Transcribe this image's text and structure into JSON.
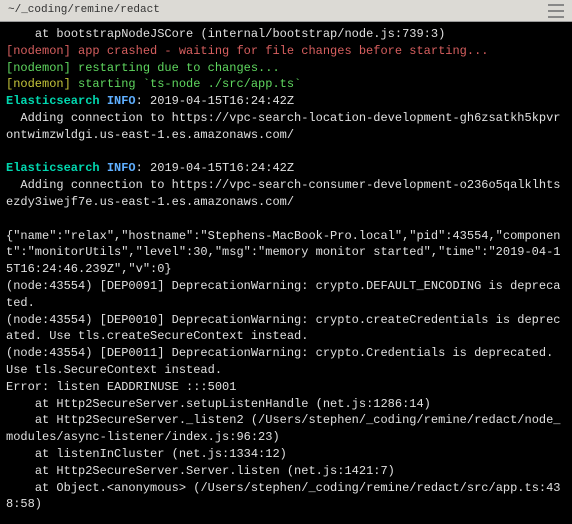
{
  "title": "~/_coding/remine/redact",
  "lines": [
    {
      "segments": [
        {
          "text": "    at bootstrapNodeJSCore (internal/bootstrap/node.js:739:3)",
          "cls": "white"
        }
      ]
    },
    {
      "segments": [
        {
          "text": "[nodemon] app crashed - waiting for file changes before starting...",
          "cls": "red"
        }
      ]
    },
    {
      "segments": [
        {
          "text": "[nodemon] restarting due to changes...",
          "cls": "green"
        }
      ]
    },
    {
      "segments": [
        {
          "text": "[nodemon] ",
          "cls": "yellow"
        },
        {
          "text": "starting `ts-node ./src/app.ts`",
          "cls": "green"
        }
      ]
    },
    {
      "segments": [
        {
          "text": "Elasticsearch ",
          "cls": "label-green"
        },
        {
          "text": "INFO",
          "cls": "label-blue"
        },
        {
          "text": ": 2019-04-15T16:24:42Z",
          "cls": "white"
        }
      ]
    },
    {
      "segments": [
        {
          "text": "  Adding connection to https://vpc-search-location-development-gh6zsatkh5kpvrontwimzwldgi.us-east-1.es.amazonaws.com/",
          "cls": "white"
        }
      ]
    },
    {
      "segments": [
        {
          "text": " ",
          "cls": "white"
        }
      ]
    },
    {
      "segments": [
        {
          "text": "Elasticsearch ",
          "cls": "label-green"
        },
        {
          "text": "INFO",
          "cls": "label-blue"
        },
        {
          "text": ": 2019-04-15T16:24:42Z",
          "cls": "white"
        }
      ]
    },
    {
      "segments": [
        {
          "text": "  Adding connection to https://vpc-search-consumer-development-o236o5qalklhtsezdy3iwejf7e.us-east-1.es.amazonaws.com/",
          "cls": "white"
        }
      ]
    },
    {
      "segments": [
        {
          "text": " ",
          "cls": "white"
        }
      ]
    },
    {
      "segments": [
        {
          "text": "{\"name\":\"relax\",\"hostname\":\"Stephens-MacBook-Pro.local\",\"pid\":43554,\"component\":\"monitorUtils\",\"level\":30,\"msg\":\"memory monitor started\",\"time\":\"2019-04-15T16:24:46.239Z\",\"v\":0}",
          "cls": "white"
        }
      ]
    },
    {
      "segments": [
        {
          "text": "(node:43554) [DEP0091] DeprecationWarning: crypto.DEFAULT_ENCODING is deprecated.",
          "cls": "white"
        }
      ]
    },
    {
      "segments": [
        {
          "text": "(node:43554) [DEP0010] DeprecationWarning: crypto.createCredentials is deprecated. Use tls.createSecureContext instead.",
          "cls": "white"
        }
      ]
    },
    {
      "segments": [
        {
          "text": "(node:43554) [DEP0011] DeprecationWarning: crypto.Credentials is deprecated. Use tls.SecureContext instead.",
          "cls": "white"
        }
      ]
    },
    {
      "segments": [
        {
          "text": "Error: listen EADDRINUSE :::5001",
          "cls": "white"
        }
      ]
    },
    {
      "segments": [
        {
          "text": "    at Http2SecureServer.setupListenHandle (net.js:1286:14)",
          "cls": "white"
        }
      ]
    },
    {
      "segments": [
        {
          "text": "    at Http2SecureServer._listen2 (/Users/stephen/_coding/remine/redact/node_modules/async-listener/index.js:96:23)",
          "cls": "white"
        }
      ]
    },
    {
      "segments": [
        {
          "text": "    at listenInCluster (net.js:1334:12)",
          "cls": "white"
        }
      ]
    },
    {
      "segments": [
        {
          "text": "    at Http2SecureServer.Server.listen (net.js:1421:7)",
          "cls": "white"
        }
      ]
    },
    {
      "segments": [
        {
          "text": "    at Object.<anonymous> (/Users/stephen/_coding/remine/redact/src/app.ts:438:58)",
          "cls": "white"
        }
      ]
    }
  ]
}
